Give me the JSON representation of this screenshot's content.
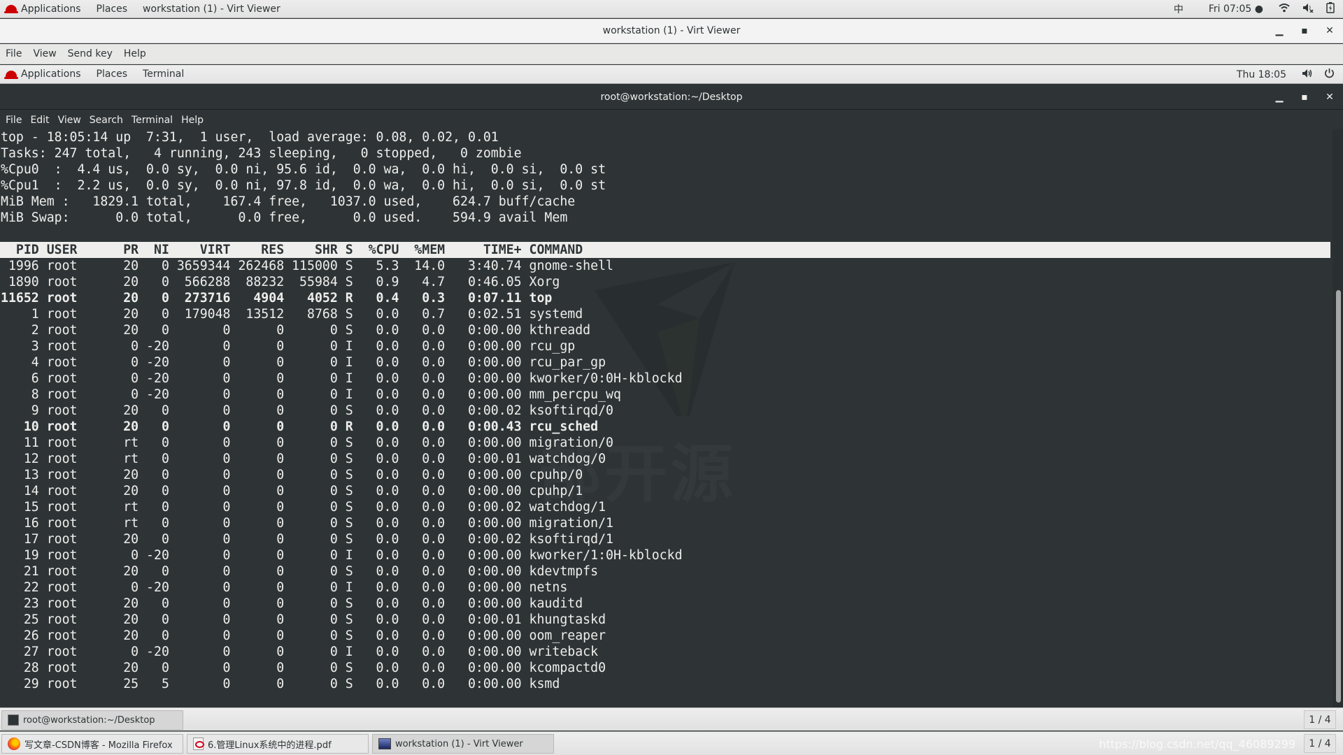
{
  "host_topbar": {
    "applications": "Applications",
    "places": "Places",
    "window": "workstation (1) - Virt Viewer",
    "input_method": "中",
    "clock": "Fri 07:05 ●",
    "icons": [
      "wifi-icon",
      "volume-muted-icon",
      "battery-charging-icon"
    ]
  },
  "virt_viewer": {
    "title": "workstation (1) - Virt Viewer",
    "menu": [
      "File",
      "View",
      "Send key",
      "Help"
    ],
    "controls": {
      "minimize": "_",
      "maximize": "□",
      "close": "×"
    }
  },
  "guest_topbar": {
    "applications": "Applications",
    "places": "Places",
    "terminal": "Terminal",
    "clock": "Thu 18:05",
    "icons": [
      "volume-icon",
      "power-icon"
    ]
  },
  "terminal": {
    "title": "root@workstation:~/Desktop",
    "menu": [
      "File",
      "Edit",
      "View",
      "Search",
      "Terminal",
      "Help"
    ],
    "summary": [
      "top - 18:05:14 up  7:31,  1 user,  load average: 0.08, 0.02, 0.01",
      "Tasks: 247 total,   4 running, 243 sleeping,   0 stopped,   0 zombie",
      "%Cpu0  :  4.4 us,  0.0 sy,  0.0 ni, 95.6 id,  0.0 wa,  0.0 hi,  0.0 si,  0.0 st",
      "%Cpu1  :  2.2 us,  0.0 sy,  0.0 ni, 97.8 id,  0.0 wa,  0.0 hi,  0.0 si,  0.0 st",
      "MiB Mem :   1829.1 total,    167.4 free,   1037.0 used,    624.7 buff/cache",
      "MiB Swap:      0.0 total,      0.0 free,      0.0 used.    594.9 avail Mem"
    ],
    "columns": [
      "PID",
      "USER",
      "PR",
      "NI",
      "VIRT",
      "RES",
      "SHR",
      "S",
      "%CPU",
      "%MEM",
      "TIME+",
      "COMMAND"
    ],
    "processes": [
      {
        "pid": "1996",
        "user": "root",
        "pr": "20",
        "ni": "0",
        "virt": "3659344",
        "res": "262468",
        "shr": "115000",
        "s": "S",
        "cpu": "5.3",
        "mem": "14.0",
        "time": "3:40.74",
        "cmd": "gnome-shell",
        "bold": false
      },
      {
        "pid": "1890",
        "user": "root",
        "pr": "20",
        "ni": "0",
        "virt": "566288",
        "res": "88232",
        "shr": "55984",
        "s": "S",
        "cpu": "0.9",
        "mem": "4.7",
        "time": "0:46.05",
        "cmd": "Xorg",
        "bold": false
      },
      {
        "pid": "11652",
        "user": "root",
        "pr": "20",
        "ni": "0",
        "virt": "273716",
        "res": "4904",
        "shr": "4052",
        "s": "R",
        "cpu": "0.4",
        "mem": "0.3",
        "time": "0:07.11",
        "cmd": "top",
        "bold": true
      },
      {
        "pid": "1",
        "user": "root",
        "pr": "20",
        "ni": "0",
        "virt": "179048",
        "res": "13512",
        "shr": "8768",
        "s": "S",
        "cpu": "0.0",
        "mem": "0.7",
        "time": "0:02.51",
        "cmd": "systemd",
        "bold": false
      },
      {
        "pid": "2",
        "user": "root",
        "pr": "20",
        "ni": "0",
        "virt": "0",
        "res": "0",
        "shr": "0",
        "s": "S",
        "cpu": "0.0",
        "mem": "0.0",
        "time": "0:00.00",
        "cmd": "kthreadd",
        "bold": false
      },
      {
        "pid": "3",
        "user": "root",
        "pr": "0",
        "ni": "-20",
        "virt": "0",
        "res": "0",
        "shr": "0",
        "s": "I",
        "cpu": "0.0",
        "mem": "0.0",
        "time": "0:00.00",
        "cmd": "rcu_gp",
        "bold": false
      },
      {
        "pid": "4",
        "user": "root",
        "pr": "0",
        "ni": "-20",
        "virt": "0",
        "res": "0",
        "shr": "0",
        "s": "I",
        "cpu": "0.0",
        "mem": "0.0",
        "time": "0:00.00",
        "cmd": "rcu_par_gp",
        "bold": false
      },
      {
        "pid": "6",
        "user": "root",
        "pr": "0",
        "ni": "-20",
        "virt": "0",
        "res": "0",
        "shr": "0",
        "s": "I",
        "cpu": "0.0",
        "mem": "0.0",
        "time": "0:00.00",
        "cmd": "kworker/0:0H-kblockd",
        "bold": false
      },
      {
        "pid": "8",
        "user": "root",
        "pr": "0",
        "ni": "-20",
        "virt": "0",
        "res": "0",
        "shr": "0",
        "s": "I",
        "cpu": "0.0",
        "mem": "0.0",
        "time": "0:00.00",
        "cmd": "mm_percpu_wq",
        "bold": false
      },
      {
        "pid": "9",
        "user": "root",
        "pr": "20",
        "ni": "0",
        "virt": "0",
        "res": "0",
        "shr": "0",
        "s": "S",
        "cpu": "0.0",
        "mem": "0.0",
        "time": "0:00.02",
        "cmd": "ksoftirqd/0",
        "bold": false
      },
      {
        "pid": "10",
        "user": "root",
        "pr": "20",
        "ni": "0",
        "virt": "0",
        "res": "0",
        "shr": "0",
        "s": "R",
        "cpu": "0.0",
        "mem": "0.0",
        "time": "0:00.43",
        "cmd": "rcu_sched",
        "bold": true
      },
      {
        "pid": "11",
        "user": "root",
        "pr": "rt",
        "ni": "0",
        "virt": "0",
        "res": "0",
        "shr": "0",
        "s": "S",
        "cpu": "0.0",
        "mem": "0.0",
        "time": "0:00.00",
        "cmd": "migration/0",
        "bold": false
      },
      {
        "pid": "12",
        "user": "root",
        "pr": "rt",
        "ni": "0",
        "virt": "0",
        "res": "0",
        "shr": "0",
        "s": "S",
        "cpu": "0.0",
        "mem": "0.0",
        "time": "0:00.01",
        "cmd": "watchdog/0",
        "bold": false
      },
      {
        "pid": "13",
        "user": "root",
        "pr": "20",
        "ni": "0",
        "virt": "0",
        "res": "0",
        "shr": "0",
        "s": "S",
        "cpu": "0.0",
        "mem": "0.0",
        "time": "0:00.00",
        "cmd": "cpuhp/0",
        "bold": false
      },
      {
        "pid": "14",
        "user": "root",
        "pr": "20",
        "ni": "0",
        "virt": "0",
        "res": "0",
        "shr": "0",
        "s": "S",
        "cpu": "0.0",
        "mem": "0.0",
        "time": "0:00.00",
        "cmd": "cpuhp/1",
        "bold": false
      },
      {
        "pid": "15",
        "user": "root",
        "pr": "rt",
        "ni": "0",
        "virt": "0",
        "res": "0",
        "shr": "0",
        "s": "S",
        "cpu": "0.0",
        "mem": "0.0",
        "time": "0:00.02",
        "cmd": "watchdog/1",
        "bold": false
      },
      {
        "pid": "16",
        "user": "root",
        "pr": "rt",
        "ni": "0",
        "virt": "0",
        "res": "0",
        "shr": "0",
        "s": "S",
        "cpu": "0.0",
        "mem": "0.0",
        "time": "0:00.00",
        "cmd": "migration/1",
        "bold": false
      },
      {
        "pid": "17",
        "user": "root",
        "pr": "20",
        "ni": "0",
        "virt": "0",
        "res": "0",
        "shr": "0",
        "s": "S",
        "cpu": "0.0",
        "mem": "0.0",
        "time": "0:00.02",
        "cmd": "ksoftirqd/1",
        "bold": false
      },
      {
        "pid": "19",
        "user": "root",
        "pr": "0",
        "ni": "-20",
        "virt": "0",
        "res": "0",
        "shr": "0",
        "s": "I",
        "cpu": "0.0",
        "mem": "0.0",
        "time": "0:00.00",
        "cmd": "kworker/1:0H-kblockd",
        "bold": false
      },
      {
        "pid": "21",
        "user": "root",
        "pr": "20",
        "ni": "0",
        "virt": "0",
        "res": "0",
        "shr": "0",
        "s": "S",
        "cpu": "0.0",
        "mem": "0.0",
        "time": "0:00.00",
        "cmd": "kdevtmpfs",
        "bold": false
      },
      {
        "pid": "22",
        "user": "root",
        "pr": "0",
        "ni": "-20",
        "virt": "0",
        "res": "0",
        "shr": "0",
        "s": "I",
        "cpu": "0.0",
        "mem": "0.0",
        "time": "0:00.00",
        "cmd": "netns",
        "bold": false
      },
      {
        "pid": "23",
        "user": "root",
        "pr": "20",
        "ni": "0",
        "virt": "0",
        "res": "0",
        "shr": "0",
        "s": "S",
        "cpu": "0.0",
        "mem": "0.0",
        "time": "0:00.00",
        "cmd": "kauditd",
        "bold": false
      },
      {
        "pid": "25",
        "user": "root",
        "pr": "20",
        "ni": "0",
        "virt": "0",
        "res": "0",
        "shr": "0",
        "s": "S",
        "cpu": "0.0",
        "mem": "0.0",
        "time": "0:00.01",
        "cmd": "khungtaskd",
        "bold": false
      },
      {
        "pid": "26",
        "user": "root",
        "pr": "20",
        "ni": "0",
        "virt": "0",
        "res": "0",
        "shr": "0",
        "s": "S",
        "cpu": "0.0",
        "mem": "0.0",
        "time": "0:00.00",
        "cmd": "oom_reaper",
        "bold": false
      },
      {
        "pid": "27",
        "user": "root",
        "pr": "0",
        "ni": "-20",
        "virt": "0",
        "res": "0",
        "shr": "0",
        "s": "I",
        "cpu": "0.0",
        "mem": "0.0",
        "time": "0:00.00",
        "cmd": "writeback",
        "bold": false
      },
      {
        "pid": "28",
        "user": "root",
        "pr": "20",
        "ni": "0",
        "virt": "0",
        "res": "0",
        "shr": "0",
        "s": "S",
        "cpu": "0.0",
        "mem": "0.0",
        "time": "0:00.00",
        "cmd": "kcompactd0",
        "bold": false
      },
      {
        "pid": "29",
        "user": "root",
        "pr": "25",
        "ni": "5",
        "virt": "0",
        "res": "0",
        "shr": "0",
        "s": "S",
        "cpu": "0.0",
        "mem": "0.0",
        "time": "0:00.00",
        "cmd": "ksmd",
        "bold": false
      }
    ],
    "watermark_text": "部开源"
  },
  "guest_taskbar": {
    "tasks": [
      {
        "label": "root@workstation:~/Desktop",
        "icon": "terminal-icon"
      }
    ],
    "pager": "1 / 4"
  },
  "host_taskbar": {
    "tasks": [
      {
        "label": "写文章-CSDN博客 - Mozilla Firefox",
        "icon": "firefox-icon"
      },
      {
        "label": "6.管理Linux系统中的进程.pdf",
        "icon": "pdf-icon"
      },
      {
        "label": "workstation (1) - Virt Viewer",
        "icon": "virt-viewer-icon"
      }
    ],
    "watermark": "https://blog.csdn.net/qq_46089299",
    "pager": "1 / 4"
  }
}
